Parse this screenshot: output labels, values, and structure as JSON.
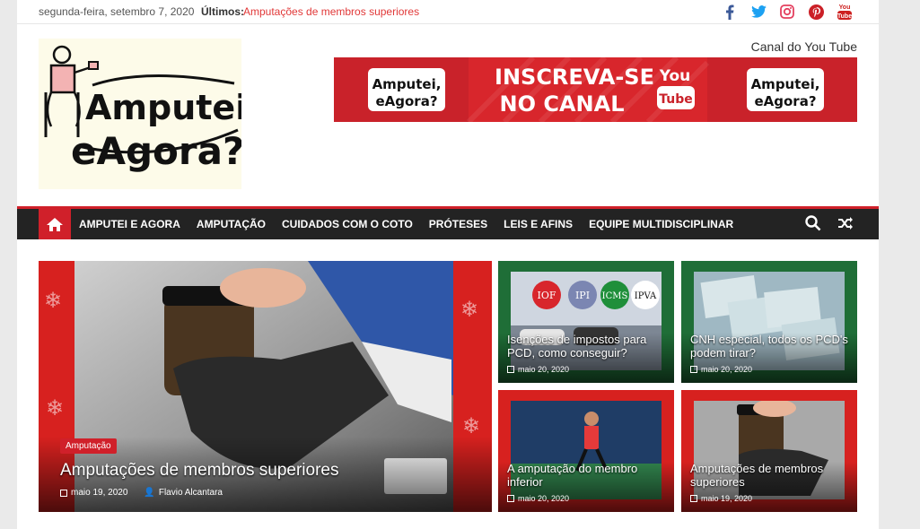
{
  "topbar": {
    "date": "segunda-feira, setembro 7, 2020",
    "latest_label": "Últimos:",
    "latest_link": "Amputações de membros superiores"
  },
  "social": [
    "facebook-icon",
    "twitter-icon",
    "instagram-icon",
    "pinterest-icon",
    "youtube-icon"
  ],
  "header": {
    "logo_text_1": "Amputei,",
    "logo_text_2": "eAgora?",
    "yt_label": "Canal do You Tube",
    "yt_banner_line1": "INSCREVA-SE",
    "yt_banner_line2": "NO CANAL",
    "yt_badge_1": "You",
    "yt_badge_2": "Tube",
    "banner_logo_1": "Amputei,",
    "banner_logo_2": "eAgora?"
  },
  "nav": {
    "items": [
      "AMPUTEI E AGORA",
      "AMPUTAÇÃO",
      "CUIDADOS COM O COTO",
      "PRÓTESES",
      "LEIS E AFINS",
      "EQUIPE MULTIDISCIPLINAR"
    ]
  },
  "featured": {
    "category": "Amputação",
    "title": "Amputações de membros superiores",
    "date": "maio 19, 2020",
    "author": "Flavio Alcantara"
  },
  "tiles": [
    {
      "title": "Isenções de impostos para PCD, como conseguir?",
      "date": "maio 20, 2020",
      "tags": [
        "IOF",
        "IPI",
        "ICMS",
        "IPVA"
      ]
    },
    {
      "title": "CNH especial, todos os PCD's podem tirar?",
      "date": "maio 20, 2020"
    },
    {
      "title": "A amputação do membro inferior",
      "date": "maio 20, 2020"
    },
    {
      "title": "Amputações de membros superiores",
      "date": "maio 19, 2020"
    }
  ],
  "colors": {
    "accent": "#d0202a",
    "nav_bg": "#232323",
    "link": "#e13838"
  }
}
